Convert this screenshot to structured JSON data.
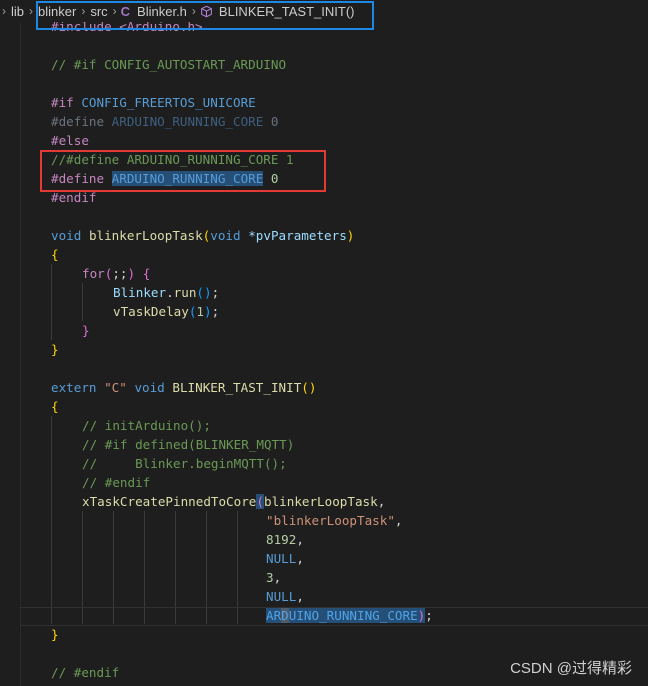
{
  "breadcrumb": {
    "items": [
      "lib",
      "blinker",
      "src",
      "Blinker.h",
      "BLINKER_TAST_INIT()"
    ],
    "file_icon_letter": "C"
  },
  "code": {
    "l1": "#include <Arduino.h>",
    "l2_comment": "// #if CONFIG_AUTOSTART_ARDUINO",
    "l3_directive": "#if",
    "l3_macro": "CONFIG_FREERTOS_UNICORE",
    "l4_directive": "#define",
    "l4_macro": "ARDUINO_RUNNING_CORE",
    "l4_value": "0",
    "l5": "#else",
    "l6_comment": "//#define ARDUINO_RUNNING_CORE 1",
    "l7_directive": "#define",
    "l7_macro": "ARDUINO_RUNNING_CORE",
    "l7_value": "0",
    "l8": "#endif",
    "fn1_return": "void",
    "fn1_name": "blinkerLoopTask",
    "fn1_param_type": "void",
    "fn1_param": "*pvParameters",
    "for_kw": "for",
    "for_cond": ";;",
    "run_obj": "Blinker",
    "run_method": "run",
    "delay_fn": "vTaskDelay",
    "delay_arg": "1",
    "extern_kw": "extern",
    "extern_str": "\"C\"",
    "fn2_return": "void",
    "fn2_name": "BLINKER_TAST_INIT",
    "c1": "// initArduino();",
    "c2": "// #if defined(BLINKER_MQTT)",
    "c3": "//     Blinker.beginMQTT();",
    "c4": "// #endif",
    "create_fn": "xTaskCreatePinnedToCore",
    "arg1": "blinkerLoopTask",
    "arg2": "\"blinkerLoopTask\"",
    "arg3": "8192",
    "arg4": "NULL",
    "arg5": "3",
    "arg6": "NULL",
    "arg7_a": "AR",
    "arg7_b": "D",
    "arg7_c": "UINO_RUNNING_CORE",
    "last_comment": "// #endif"
  },
  "watermark": "CSDN @过得精彩",
  "colors": {
    "background": "#1e1e1e",
    "highlight_box_blue": "#1e88e5",
    "highlight_box_red": "#e53935",
    "selection": "#264f78"
  }
}
